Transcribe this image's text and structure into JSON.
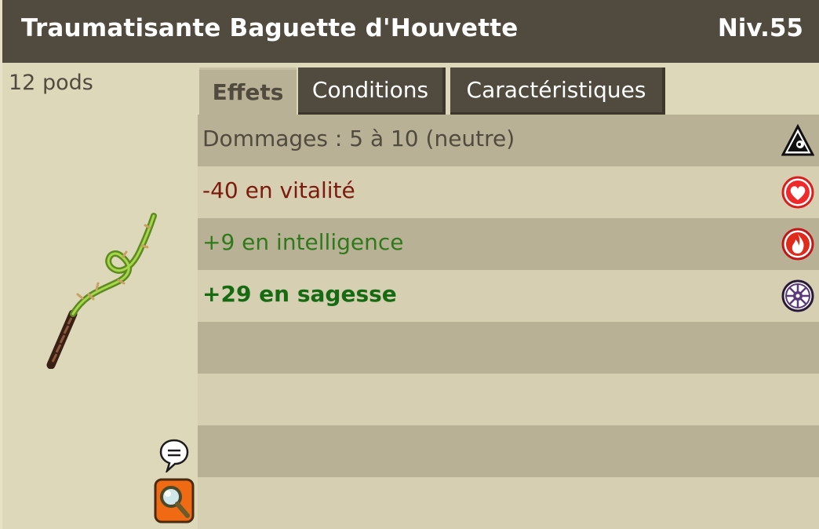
{
  "header": {
    "title": "Traumatisante Baguette d'Houvette",
    "level": "Niv.55"
  },
  "item": {
    "weight": "12 pods"
  },
  "tabs": [
    {
      "label": "Effets",
      "active": true
    },
    {
      "label": "Conditions",
      "active": false
    },
    {
      "label": "Caractéristiques",
      "active": false
    }
  ],
  "effects": [
    {
      "text": "Dommages : 5 à 10 (neutre)",
      "icon": "neutral-element-icon"
    },
    {
      "text": "-40 en vitalité",
      "icon": "vitality-heart-icon"
    },
    {
      "text": "+9 en intelligence",
      "icon": "intelligence-fire-icon"
    },
    {
      "text": "+29 en sagesse",
      "icon": "wisdom-eye-icon"
    }
  ],
  "colors": {
    "header_bg": "#514a3e",
    "panel_bg": "#ddd8b9",
    "row_dark": "#b9b196",
    "row_light": "#d6cfb1",
    "malus": "#7b1a0d",
    "bonus": "#2e7a1a"
  }
}
